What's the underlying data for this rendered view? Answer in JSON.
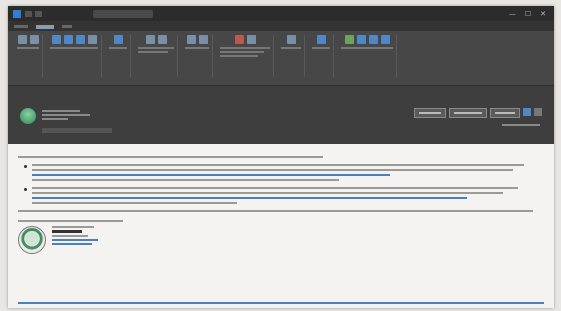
{
  "window": {
    "title": "",
    "controls": [
      "—",
      "☐",
      "✕"
    ]
  },
  "menubar": {
    "tabs": []
  },
  "header": {
    "subject": "",
    "sender_line": "",
    "actions": []
  },
  "body": {
    "greeting": "",
    "intro": "",
    "closing": "",
    "sign_off": ""
  },
  "colors": {
    "accent": "#4f87c7",
    "link": "#4a7fc2",
    "brand_green": "#2c8a58"
  }
}
